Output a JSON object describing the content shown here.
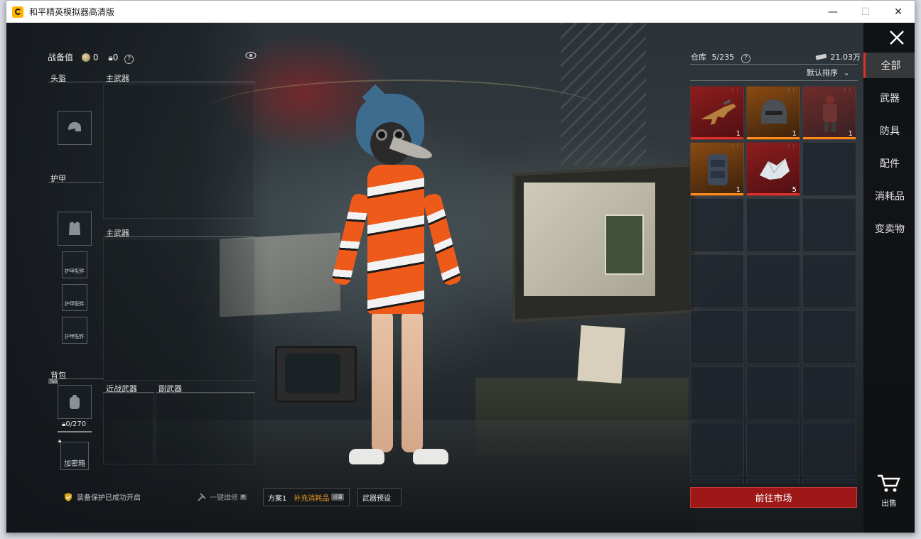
{
  "window": {
    "title": "和平精英模拟器高清版",
    "controls": {
      "minimize": "—",
      "maximize": "☐",
      "close": "✕"
    }
  },
  "loadout": {
    "power_label": "战备值",
    "power_value": "0",
    "lock_value": "0",
    "helmet_label": "头盔",
    "primary1_label": "主武器",
    "armor_label": "护甲",
    "primary2_label": "主武器",
    "armor_attachment_labels": [
      "护甲配件",
      "护甲配件",
      "护甲配件"
    ],
    "backpack_label": "背包",
    "backpack_tab": "Tab",
    "backpack_capacity": "0/270",
    "melee_label": "近战武器",
    "secondary_label": "副武器",
    "safe_label": "加密箱"
  },
  "bottom_bar": {
    "protection_text": "装备保护已成功开启",
    "repair_text": "一键维修",
    "repair_tag": "R",
    "plan_label": "方案1",
    "refill_label": "补充消耗品",
    "refill_tag": "设置",
    "weapon_preset_label": "武器预设"
  },
  "inventory": {
    "storage_label": "仓库",
    "storage_count": "5/235",
    "currency": "21.03万",
    "sort_label": "默认排序",
    "items": [
      {
        "name": "rifle-icon",
        "count": "1",
        "rarity": "red"
      },
      {
        "name": "helmet-icon",
        "count": "1",
        "rarity": "orange"
      },
      {
        "name": "armor-suit-icon",
        "count": "1",
        "rarity": "orange-red"
      },
      {
        "name": "backpack-armor-icon",
        "count": "1",
        "rarity": "orange"
      },
      {
        "name": "crystal-icon",
        "count": "5",
        "rarity": "red"
      }
    ],
    "market_button": "前往市场"
  },
  "sidenav": {
    "items": [
      "全部",
      "武器",
      "防具",
      "配件",
      "消耗品",
      "变卖物"
    ],
    "active_index": 0,
    "sell_label": "出售"
  },
  "colors": {
    "accent_red": "#9e1818",
    "rarity_orange": "#ff8a1a",
    "rarity_red": "#e0302a"
  }
}
